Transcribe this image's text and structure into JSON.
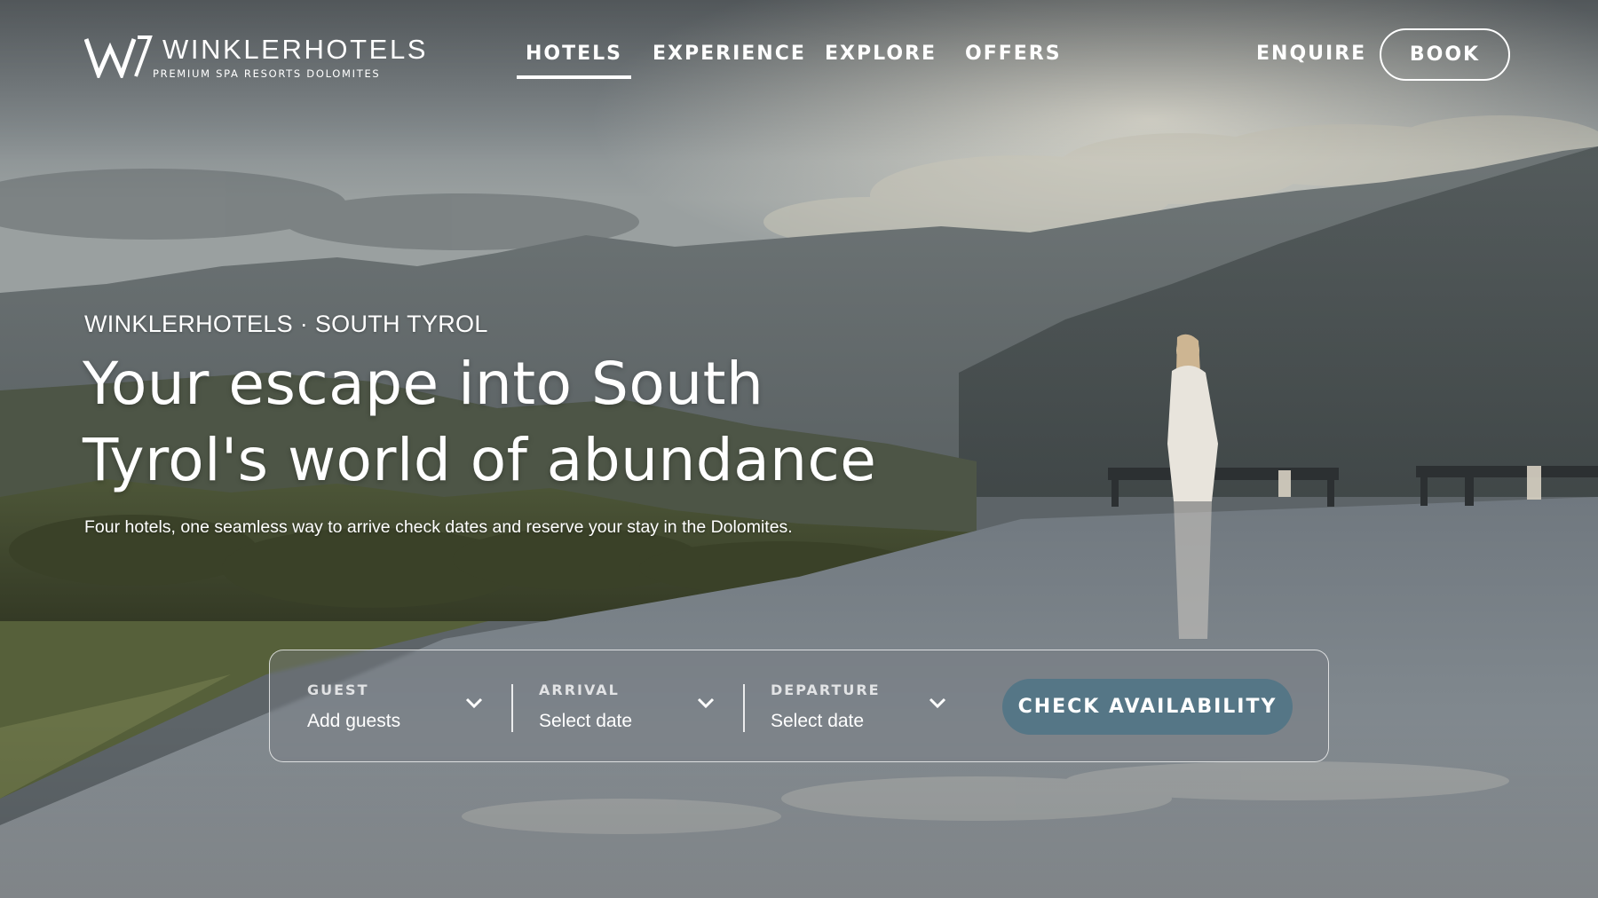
{
  "brand": {
    "name": "WINKLERHOTELS",
    "tagline": "PREMIUM SPA RESORTS DOLOMITES"
  },
  "nav": {
    "items": [
      {
        "label": "HOTELS",
        "active": true
      },
      {
        "label": "EXPERIENCE",
        "active": false
      },
      {
        "label": "EXPLORE",
        "active": false
      },
      {
        "label": "OFFERS",
        "active": false
      }
    ],
    "enquire_label": "ENQUIRE",
    "book_label": "BOOK"
  },
  "hero": {
    "eyebrow": "WINKLERHOTELS · SOUTH TYROL",
    "headline_line1": "Your escape into South",
    "headline_line2": "Tyrol's world of abundance",
    "subline": "Four hotels, one seamless way to arrive check dates and reserve your stay in the Dolomites."
  },
  "booking": {
    "guest": {
      "label": "GUEST",
      "value": "Add guests"
    },
    "arrival": {
      "label": "ARRIVAL",
      "value": "Select date"
    },
    "departure": {
      "label": "DEPARTURE",
      "value": "Select date"
    },
    "cta_label": "CHECK AVAILABILITY"
  },
  "colors": {
    "accent": "#557686",
    "text": "#ffffff"
  },
  "icons": {
    "logo": "w-logo-icon",
    "dropdown": "chevron-down-icon"
  }
}
